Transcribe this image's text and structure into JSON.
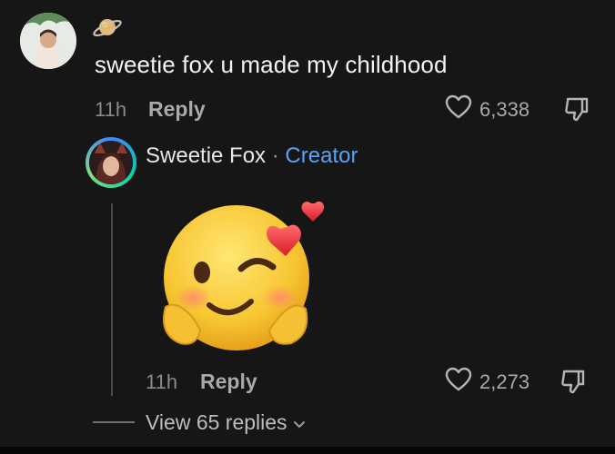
{
  "comment": {
    "text": "sweetie fox u made my childhood",
    "time": "11h",
    "reply_label": "Reply",
    "likes": "6,338",
    "badge_icon": "ringed-planet-icon"
  },
  "reply": {
    "author": "Sweetie Fox",
    "separator": "·",
    "author_badge": "Creator",
    "content_icon": "winking-face-with-hearts-emoji",
    "time": "11h",
    "reply_label": "Reply",
    "likes": "2,273"
  },
  "thread": {
    "view_replies_label": "View 65 replies"
  },
  "colors": {
    "background": "#161616",
    "creator_label": "#5aa3f2",
    "muted_text": "#a9a9a9"
  }
}
